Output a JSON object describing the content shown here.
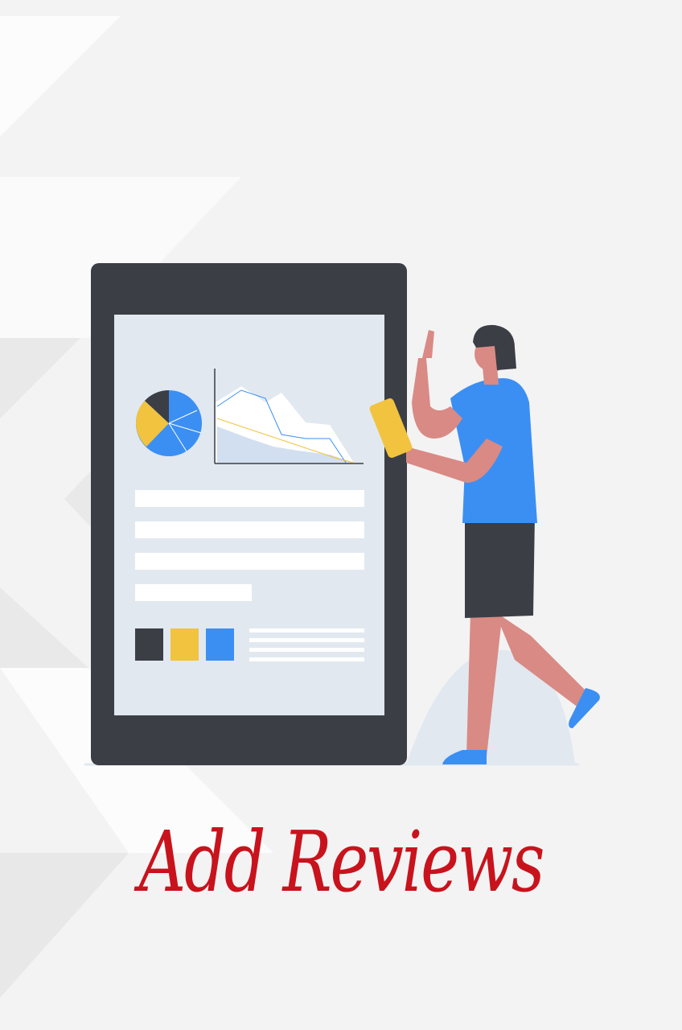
{
  "caption": "Add Reviews",
  "colors": {
    "background": "#f3f3f3",
    "tablet_frame": "#3b3e45",
    "tablet_screen": "#e1e8f0",
    "accent_blue": "#3b8ff3",
    "accent_yellow": "#f1c33f",
    "dark": "#3b3e45",
    "skin": "#d98a84",
    "caption_red": "#c8131d"
  },
  "icons": [
    "pie-chart-icon",
    "line-chart-icon",
    "color-swatches"
  ]
}
